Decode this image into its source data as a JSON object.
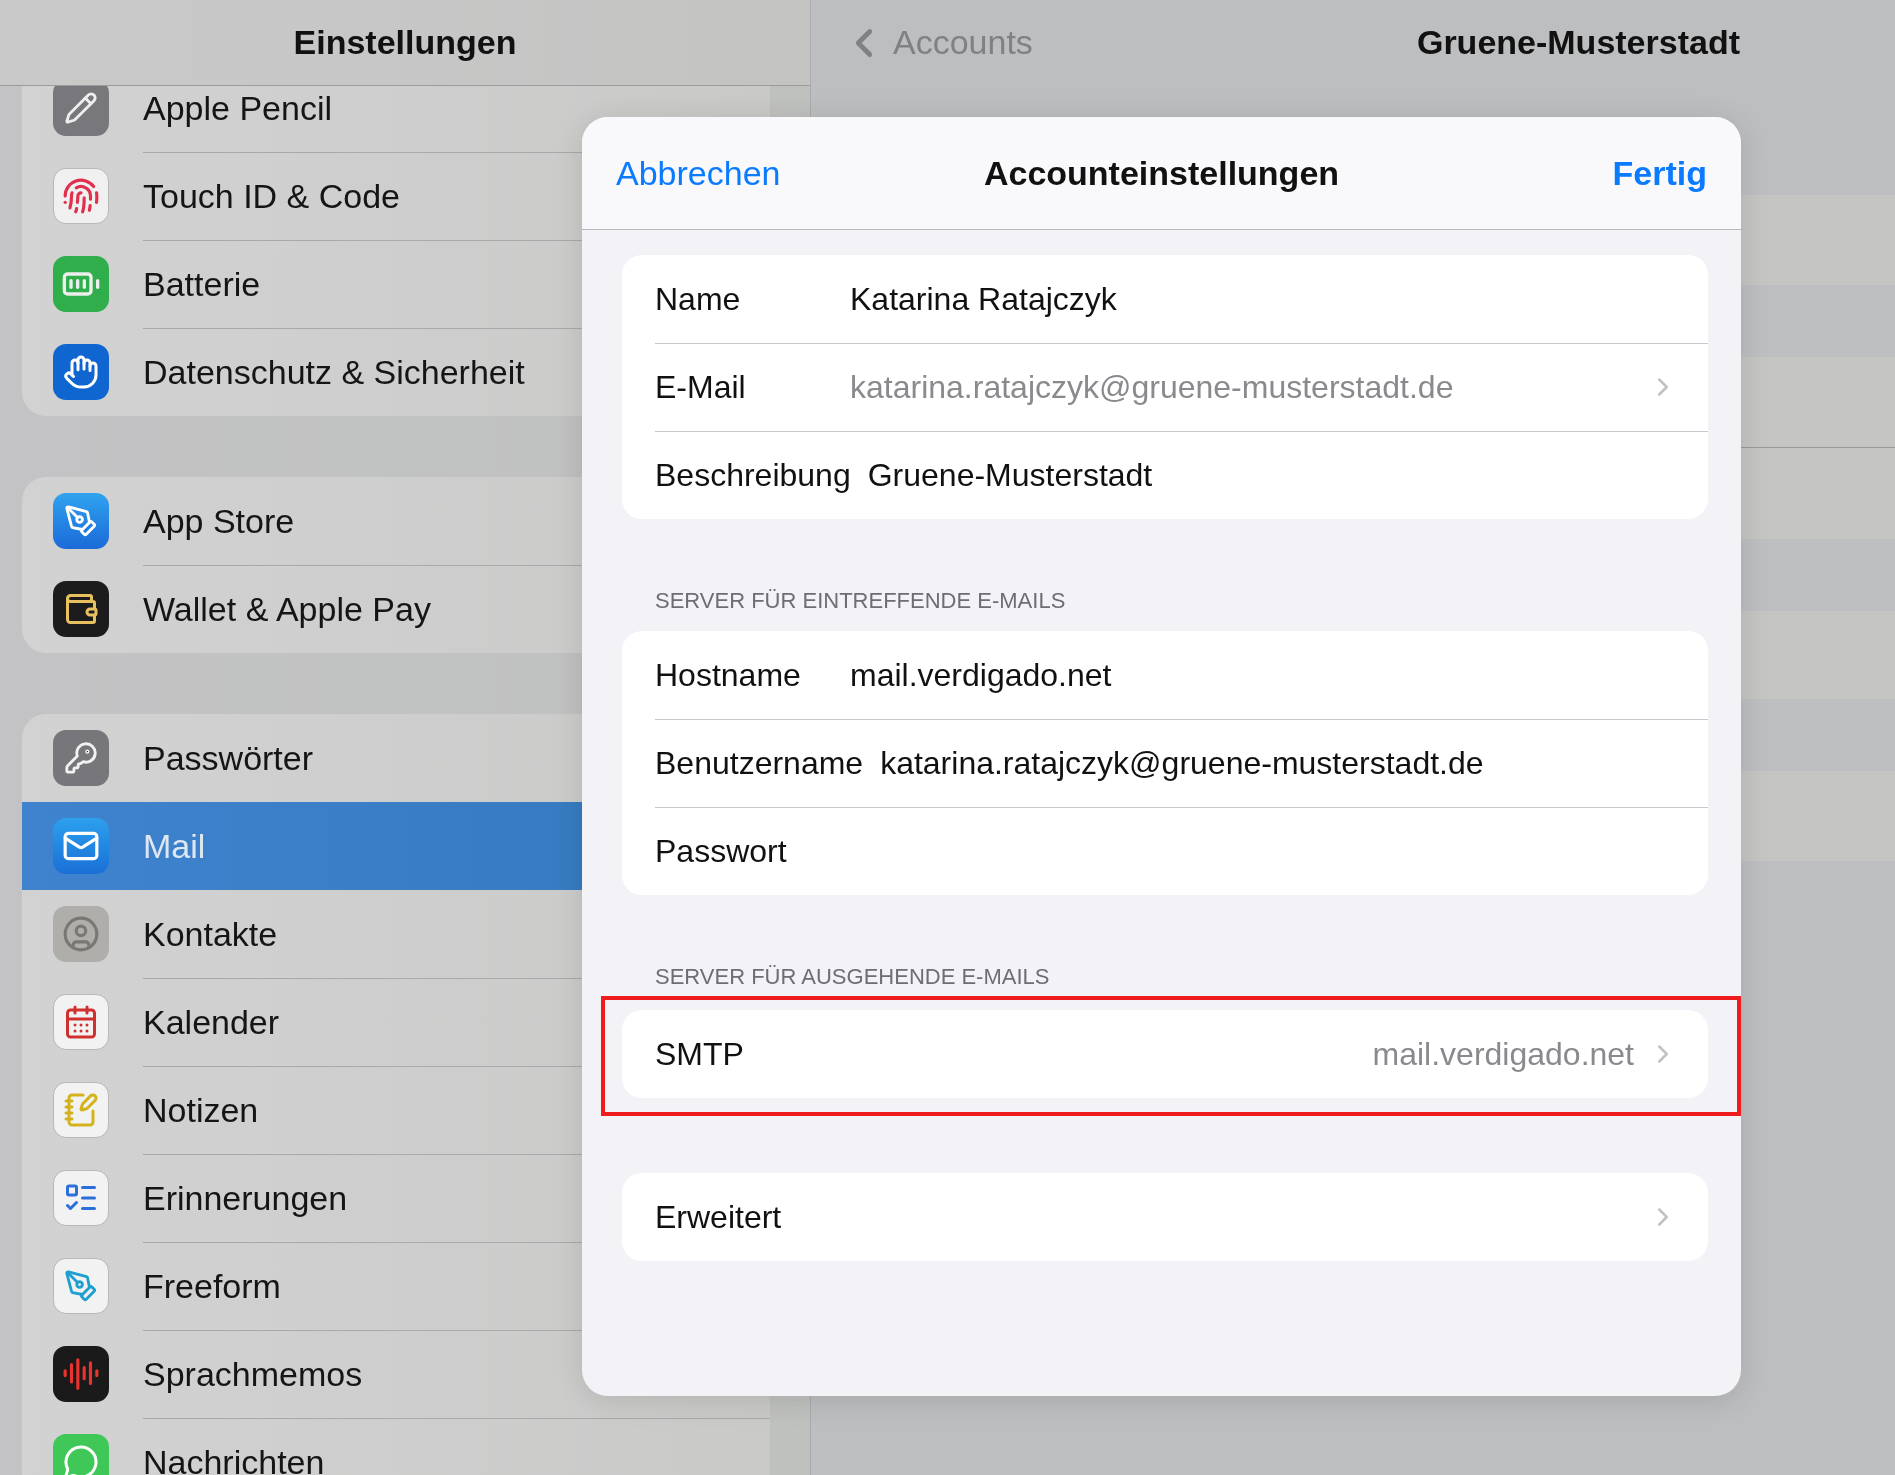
{
  "sidebar": {
    "title": "Einstellungen",
    "groups": [
      {
        "items": [
          {
            "label": "Apple Pencil",
            "selected": false
          },
          {
            "label": "Touch ID & Code",
            "selected": false
          },
          {
            "label": "Batterie",
            "selected": false
          },
          {
            "label": "Datenschutz & Sicherheit",
            "selected": false
          }
        ]
      },
      {
        "items": [
          {
            "label": "App Store",
            "selected": false
          },
          {
            "label": "Wallet & Apple Pay",
            "selected": false
          }
        ]
      },
      {
        "items": [
          {
            "label": "Passwörter",
            "selected": false
          },
          {
            "label": "Mail",
            "selected": true
          },
          {
            "label": "Kontakte",
            "selected": false
          },
          {
            "label": "Kalender",
            "selected": false
          },
          {
            "label": "Notizen",
            "selected": false
          },
          {
            "label": "Erinnerungen",
            "selected": false
          },
          {
            "label": "Freeform",
            "selected": false
          },
          {
            "label": "Sprachmemos",
            "selected": false
          },
          {
            "label": "Nachrichten",
            "selected": false
          }
        ]
      }
    ]
  },
  "detail": {
    "back": "Accounts",
    "title": "Gruene-Musterstadt"
  },
  "sheet": {
    "cancel": "Abbrechen",
    "title": "Accounteinstellungen",
    "done": "Fertig",
    "sections": [
      {
        "highlighted": false,
        "rows": [
          {
            "kind": "field",
            "label": "Name",
            "value": "Katarina Ratajczyk"
          },
          {
            "kind": "link",
            "label": "E-Mail",
            "value": "katarina.ratajczyk@gruene-musterstadt.de"
          },
          {
            "kind": "field",
            "label": "Beschreibung",
            "value": "Gruene-Musterstadt"
          }
        ]
      },
      {
        "header": "SERVER FÜR EINTREFFENDE E-MAILS",
        "highlighted": false,
        "rows": [
          {
            "kind": "field",
            "label": "Hostname",
            "value": "mail.verdigado.net"
          },
          {
            "kind": "field",
            "label": "Benutzername",
            "value": "katarina.ratajczyk@gruene-musterstadt.de"
          },
          {
            "kind": "field",
            "label": "Passwort"
          }
        ]
      },
      {
        "header": "SERVER FÜR AUSGEHENDE E-MAILS",
        "highlighted": true,
        "rows": [
          {
            "kind": "detail",
            "label": "SMTP",
            "value": "mail.verdigado.net"
          }
        ]
      },
      {
        "highlighted": false,
        "rows": [
          {
            "kind": "detail",
            "label": "Erweitert"
          }
        ]
      }
    ]
  }
}
